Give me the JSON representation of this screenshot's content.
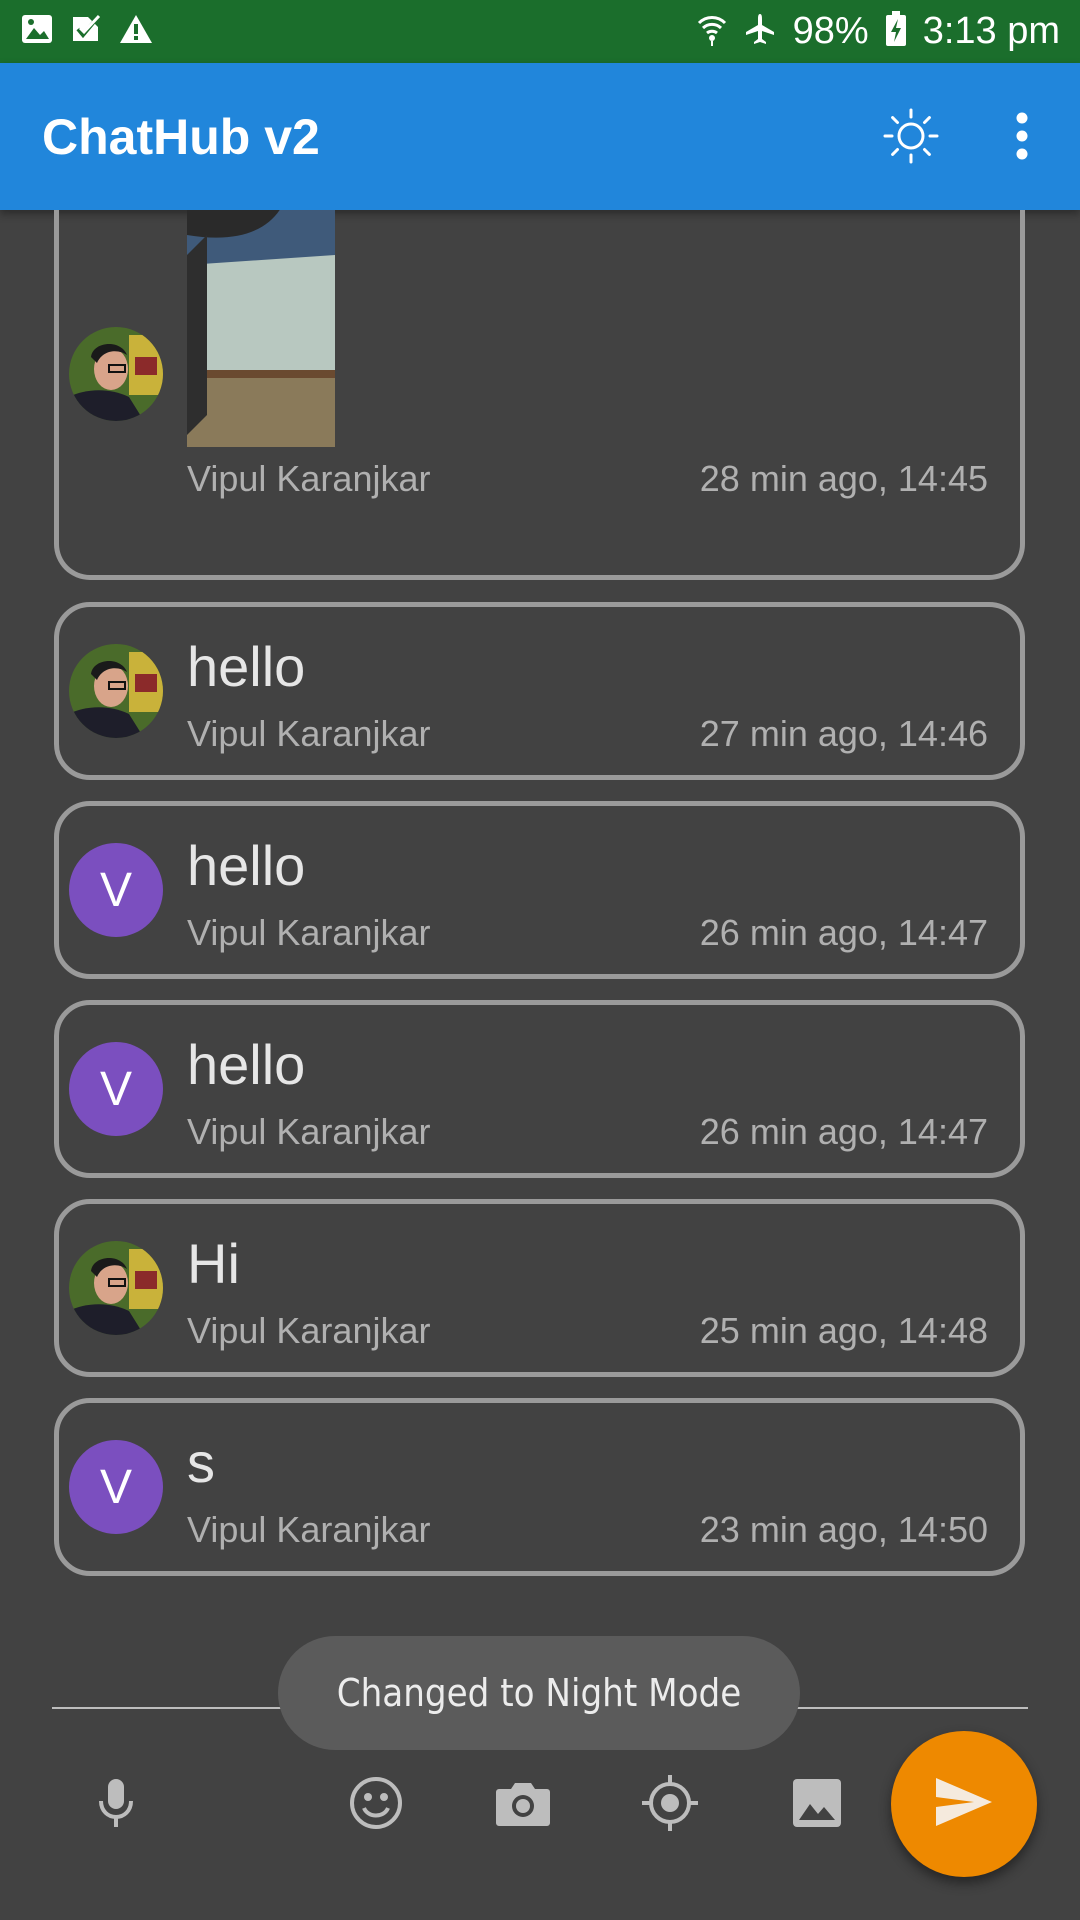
{
  "status_bar": {
    "battery": "98%",
    "time": "3:13 pm",
    "icons_left": [
      "image-icon",
      "check-note-icon",
      "warning-icon"
    ],
    "icons_right": [
      "wifi-icon",
      "airplane-icon",
      "battery-charging-icon"
    ]
  },
  "app_bar": {
    "title": "ChatHub v2",
    "actions": [
      "brightness-icon",
      "more-vert-icon"
    ]
  },
  "messages": [
    {
      "type": "image",
      "avatar": "photo",
      "sender": "Vipul Karanjkar",
      "time": "28 min ago, 14:45"
    },
    {
      "type": "text",
      "avatar": "photo",
      "text": "hello",
      "sender": "Vipul Karanjkar",
      "time": "27 min ago, 14:46"
    },
    {
      "type": "text",
      "avatar": "letter",
      "avatar_letter": "V",
      "text": "hello",
      "sender": "Vipul Karanjkar",
      "time": "26 min ago, 14:47"
    },
    {
      "type": "text",
      "avatar": "letter",
      "avatar_letter": "V",
      "text": "hello",
      "sender": "Vipul Karanjkar",
      "time": "26 min ago, 14:47"
    },
    {
      "type": "text",
      "avatar": "photo",
      "text": "Hi",
      "sender": "Vipul Karanjkar",
      "time": "25 min ago, 14:48"
    },
    {
      "type": "text",
      "avatar": "letter",
      "avatar_letter": "V",
      "text": "s",
      "sender": "Vipul Karanjkar",
      "time": "23 min ago, 14:50"
    }
  ],
  "toast": {
    "text": "Changed to Night Mode"
  },
  "toolbar": {
    "icons": [
      "mic-icon",
      "emoji-icon",
      "camera-icon",
      "location-icon",
      "gallery-icon"
    ],
    "send": "send-icon"
  },
  "colors": {
    "status_bar": "#1b6e2c",
    "app_bar": "#2186db",
    "background": "#424242",
    "avatar_letter_bg": "#7b4fbf",
    "fab": "#ee8900"
  }
}
